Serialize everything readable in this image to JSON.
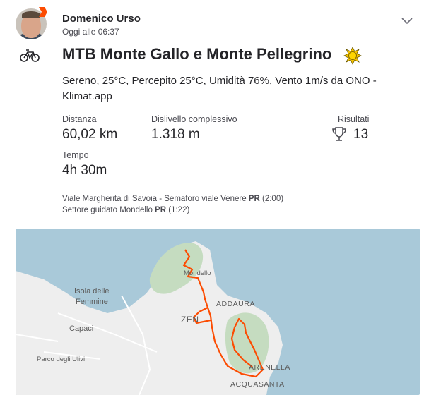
{
  "athlete": {
    "name": "Domenico Urso",
    "time": "Oggi alle 06:37"
  },
  "activity": {
    "sport_icon": "bike-icon",
    "title": "MTB Monte Gallo e Monte Pellegrino",
    "weather_icon": "sun-icon",
    "description": "Sereno, 25°C, Percepito 25°C, Umidità 76%, Vento 1m/s da ONO - Klimat.app"
  },
  "stats": {
    "distance_label": "Distanza",
    "distance_value": "60,02 km",
    "elevation_label": "Dislivello complessivo",
    "elevation_value": "1.318 m",
    "results_label": "Risultati",
    "results_value": "13",
    "time_label": "Tempo",
    "time_value": "4h 30m"
  },
  "segments": [
    {
      "name": "Viale Margherita di Savoia - Semaforo viale Venere",
      "badge": "PR",
      "time": "(2:00)"
    },
    {
      "name": "Settore guidato Mondello",
      "badge": "PR",
      "time": "(1:22)"
    }
  ],
  "map": {
    "labels": {
      "isola": "Isola delle",
      "femmine": "Femmine",
      "capaci": "Capaci",
      "parco": "Parco degli Ulivi",
      "mondello": "Mondello",
      "addaura": "ADDAURA",
      "zen": "ZEN",
      "arenella": "ARENELLA",
      "acquasanta": "ACQUASANTA"
    },
    "colors": {
      "sea": "#a9c9d9",
      "land": "#eeeeee",
      "park": "#c5dcc0",
      "route": "#fc4c02"
    }
  }
}
